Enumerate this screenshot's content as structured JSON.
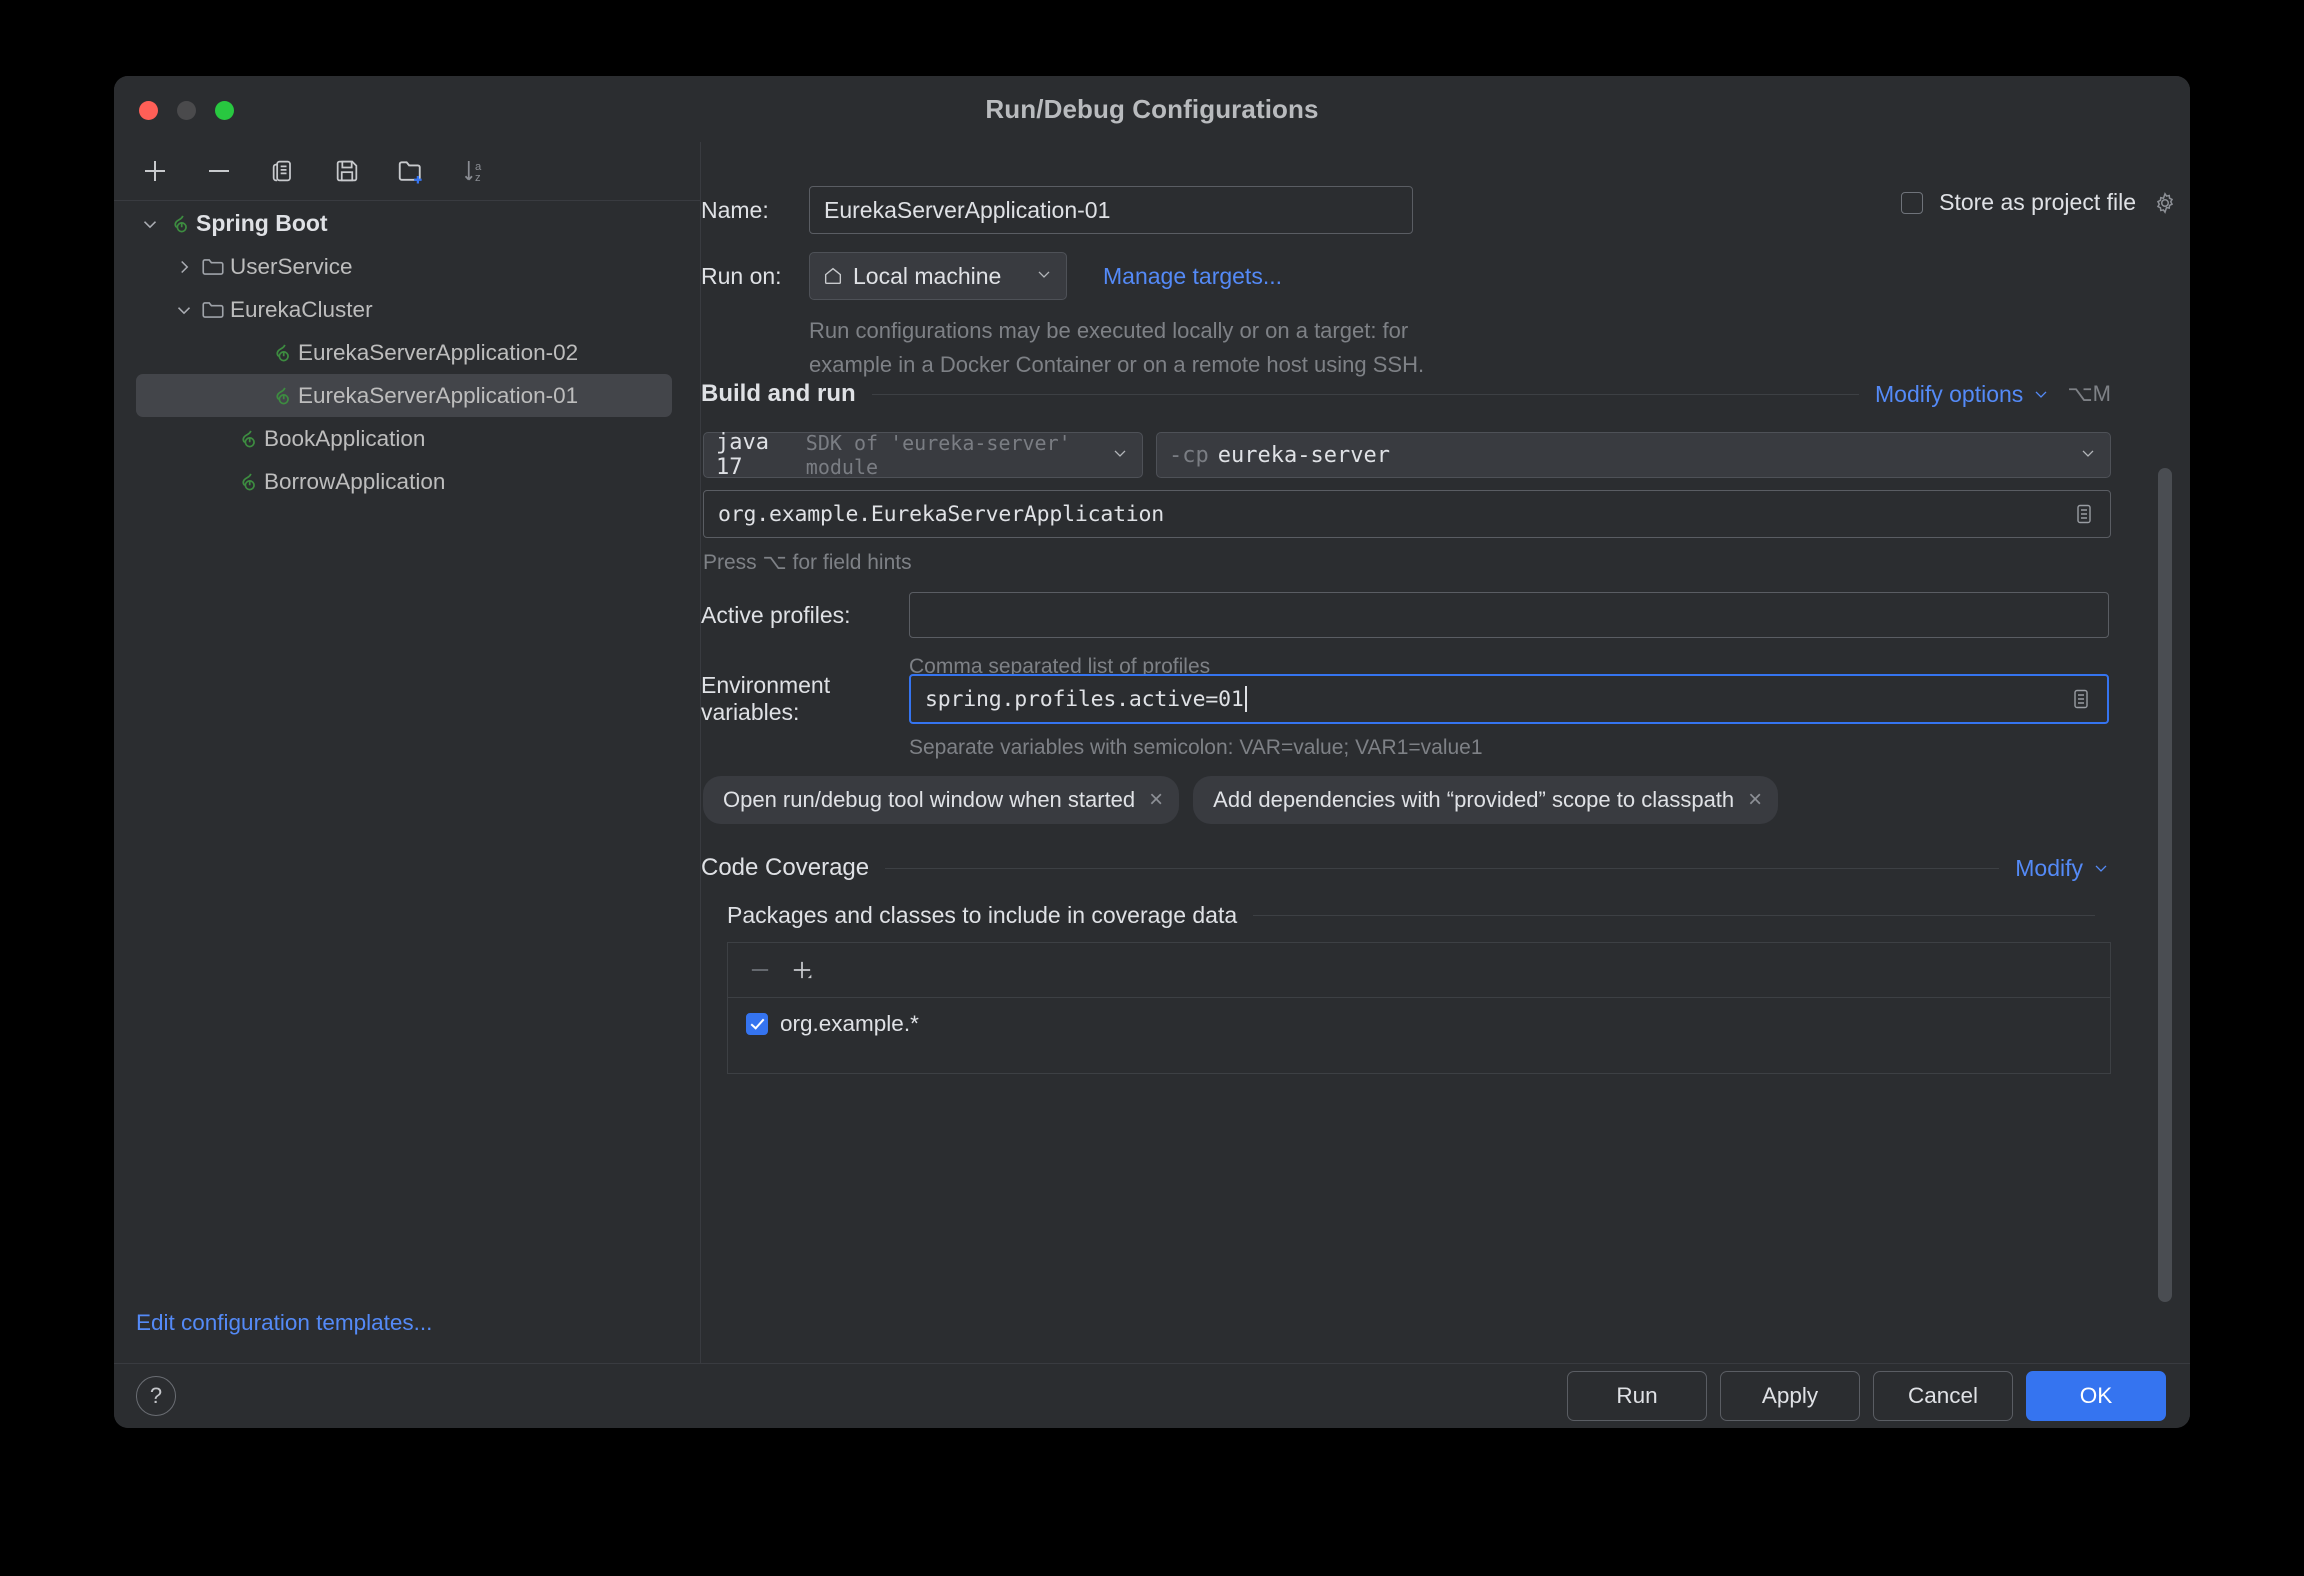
{
  "window": {
    "title": "Run/Debug Configurations",
    "traffic": [
      "close-button",
      "minimize-button",
      "zoom-button"
    ]
  },
  "sidebar": {
    "toolbar": [
      {
        "name": "add-configuration-button",
        "icon": "plus-icon"
      },
      {
        "name": "remove-configuration-button",
        "icon": "minus-icon"
      },
      {
        "name": "copy-configuration-button",
        "icon": "copy-icon"
      },
      {
        "name": "save-configuration-button",
        "icon": "save-icon"
      },
      {
        "name": "new-folder-button",
        "icon": "folder-plus-icon"
      },
      {
        "name": "sort-configurations-button",
        "icon": "sort-alpha-icon"
      }
    ],
    "tree": [
      {
        "label": "Spring Boot",
        "icon": "spring-boot-icon",
        "indent": 0,
        "expanded": true,
        "chevron": "down",
        "bold": true,
        "selected": false
      },
      {
        "label": "UserService",
        "icon": "folder-icon",
        "indent": 1,
        "expanded": false,
        "chevron": "right",
        "bold": false,
        "selected": false
      },
      {
        "label": "EurekaCluster",
        "icon": "folder-icon",
        "indent": 1,
        "expanded": true,
        "chevron": "down",
        "bold": false,
        "selected": false
      },
      {
        "label": "EurekaServerApplication-02",
        "icon": "spring-boot-icon",
        "indent": 3,
        "chevron": "none",
        "bold": false,
        "selected": false
      },
      {
        "label": "EurekaServerApplication-01",
        "icon": "spring-boot-icon",
        "indent": 3,
        "chevron": "none",
        "bold": false,
        "selected": true
      },
      {
        "label": "BookApplication",
        "icon": "spring-boot-icon",
        "indent": 2,
        "chevron": "none",
        "bold": false,
        "selected": false
      },
      {
        "label": "BorrowApplication",
        "icon": "spring-boot-icon",
        "indent": 2,
        "chevron": "none",
        "bold": false,
        "selected": false
      }
    ],
    "edit_templates_link": "Edit configuration templates..."
  },
  "form": {
    "name_label": "Name:",
    "name_value": "EurekaServerApplication-01",
    "store_as_project_file_label": "Store as project file",
    "store_as_project_file_checked": false,
    "gear_icon": "gear-icon",
    "run_on_label": "Run on:",
    "run_on_value": "Local machine",
    "run_on_icon": "home-icon",
    "manage_targets_link": "Manage targets...",
    "run_on_description_line1": "Run configurations may be executed locally or on a target: for",
    "run_on_description_line2": "example in a Docker Container or on a remote host using SSH.",
    "build_and_run_title": "Build and run",
    "modify_options_link": "Modify options",
    "modify_options_shortcut": "⌥M",
    "jdk_value": "java 17",
    "jdk_hint": "SDK of 'eureka-server' module",
    "classpath_prefix": "-cp",
    "classpath_value": "eureka-server",
    "main_class_value": "org.example.EurekaServerApplication",
    "main_class_browse_icon": "expand-field-icon",
    "field_hints_text": "Press ⌥ for field hints",
    "active_profiles_label": "Active profiles:",
    "active_profiles_value": "",
    "active_profiles_hint": "Comma separated list of profiles",
    "environment_variables_label": "Environment variables:",
    "environment_variables_value": "spring.profiles.active=01",
    "environment_variables_browse_icon": "expand-field-icon",
    "environment_variables_hint": "Separate variables with semicolon: VAR=value; VAR1=value1",
    "option_chips": [
      {
        "label": "Open run/debug tool window when started",
        "close": "×"
      },
      {
        "label": "Add dependencies with “provided” scope to classpath",
        "close": "×"
      }
    ],
    "code_coverage_title": "Code Coverage",
    "code_coverage_modify_link": "Modify",
    "coverage_subtitle": "Packages and classes to include in coverage data",
    "coverage_toolbar": [
      {
        "name": "remove-coverage-pattern-button",
        "icon": "minus-icon"
      },
      {
        "name": "add-coverage-pattern-button",
        "icon": "plus-dropdown-icon"
      }
    ],
    "coverage_rows": [
      {
        "label": "org.example.*",
        "checked": true
      }
    ]
  },
  "footer": {
    "help_label": "?",
    "buttons": [
      {
        "label": "Run",
        "name": "run-button",
        "primary": false
      },
      {
        "label": "Apply",
        "name": "apply-button",
        "primary": false
      },
      {
        "label": "Cancel",
        "name": "cancel-button",
        "primary": false
      },
      {
        "label": "OK",
        "name": "ok-button",
        "primary": true
      }
    ]
  },
  "colors": {
    "accent_blue": "#3574f0",
    "link_blue": "#548af7",
    "spring_green": "#3d8c40",
    "panel_bg": "#2b2d30",
    "selection_bg": "#43454a"
  }
}
